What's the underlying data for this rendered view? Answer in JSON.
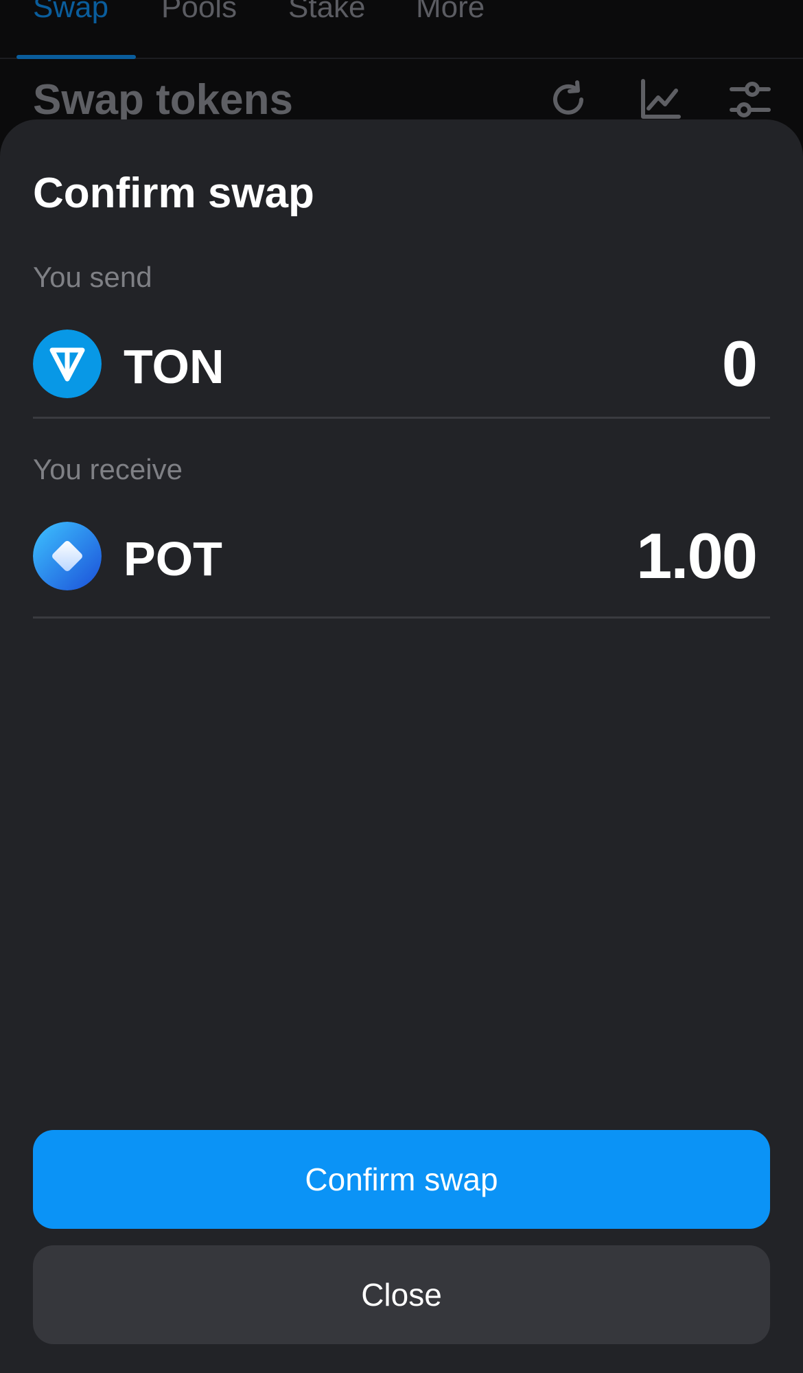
{
  "nav": {
    "tabs": [
      {
        "label": "Swap",
        "active": true
      },
      {
        "label": "Pools",
        "active": false
      },
      {
        "label": "Stake",
        "active": false
      },
      {
        "label": "More",
        "active": false
      }
    ]
  },
  "header": {
    "title": "Swap tokens",
    "icons": [
      "refresh-icon",
      "chart-icon",
      "settings-sliders-icon"
    ]
  },
  "modal": {
    "title": "Confirm swap",
    "send": {
      "label": "You send",
      "token": "TON",
      "amount": "0",
      "icon": "ton-token-icon"
    },
    "receive": {
      "label": "You receive",
      "token": "POT",
      "amount": "1.00",
      "icon": "pot-token-icon"
    },
    "confirm_label": "Confirm swap",
    "close_label": "Close"
  },
  "colors": {
    "accent": "#0b93f6",
    "sheet_bg": "#222327",
    "secondary_button": "#36373c"
  }
}
